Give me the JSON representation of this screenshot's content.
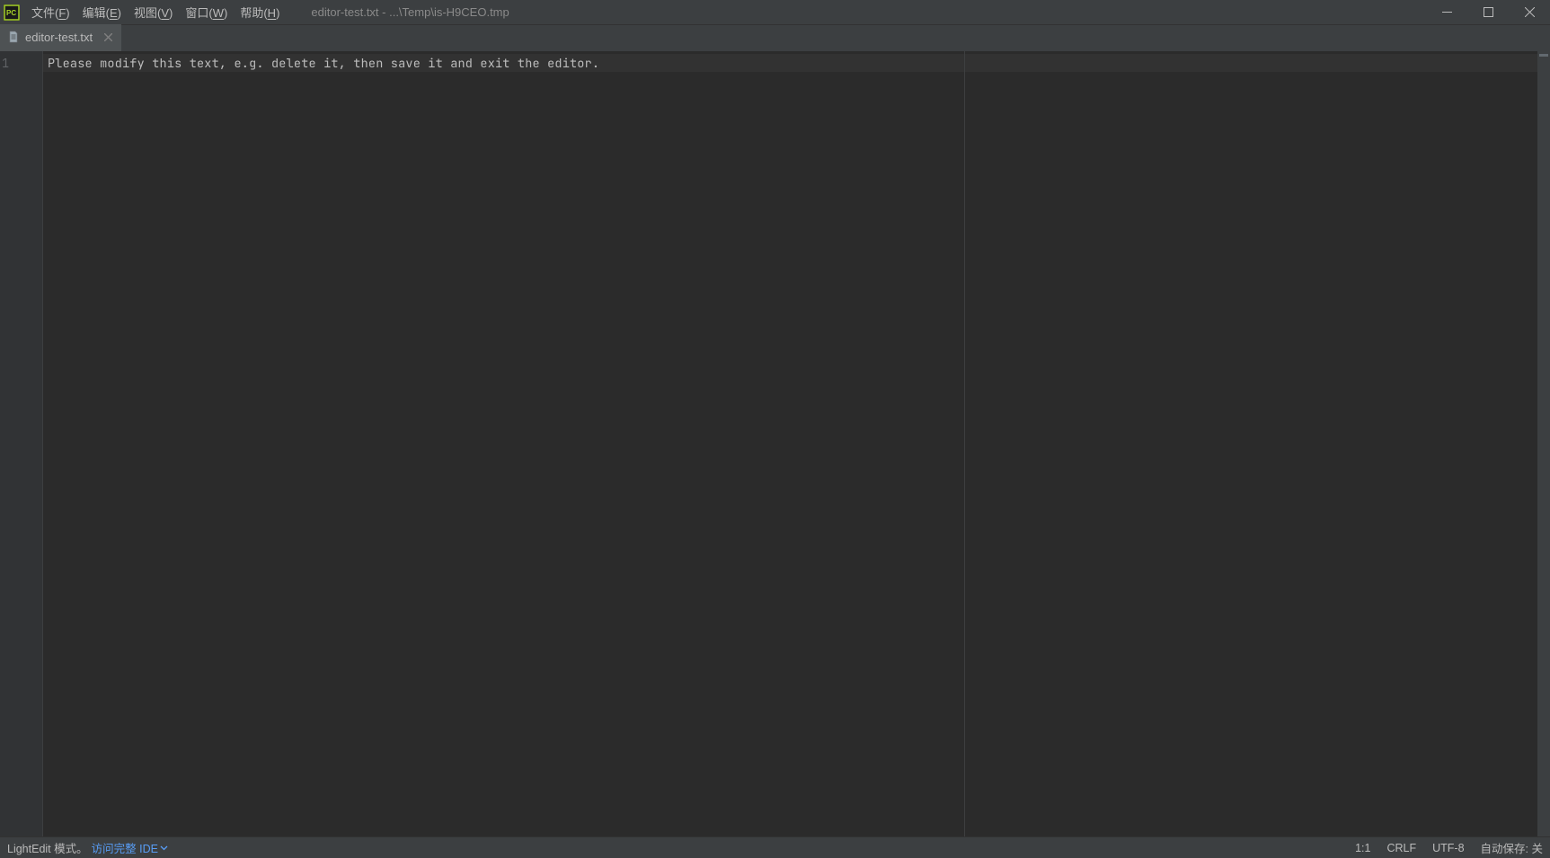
{
  "menubar": {
    "items": [
      {
        "prefix": "文件(",
        "mnemonic": "F",
        "suffix": ")"
      },
      {
        "prefix": "编辑(",
        "mnemonic": "E",
        "suffix": ")"
      },
      {
        "prefix": "视图(",
        "mnemonic": "V",
        "suffix": ")"
      },
      {
        "prefix": "窗口(",
        "mnemonic": "W",
        "suffix": ")"
      },
      {
        "prefix": "帮助(",
        "mnemonic": "H",
        "suffix": ")"
      }
    ]
  },
  "title": "editor-test.txt - ...\\Temp\\is-H9CEO.tmp",
  "tabs": {
    "active": {
      "label": "editor-test.txt"
    }
  },
  "editor": {
    "gutter_line": "1",
    "content_line": "Please modify this text, e.g. delete it, then save it and exit the editor."
  },
  "statusbar": {
    "mode_label": "LightEdit 模式。",
    "ide_link": "访问完整 IDE",
    "cursor": "1:1",
    "line_sep": "CRLF",
    "encoding": "UTF-8",
    "autosave": "自动保存: 关"
  }
}
